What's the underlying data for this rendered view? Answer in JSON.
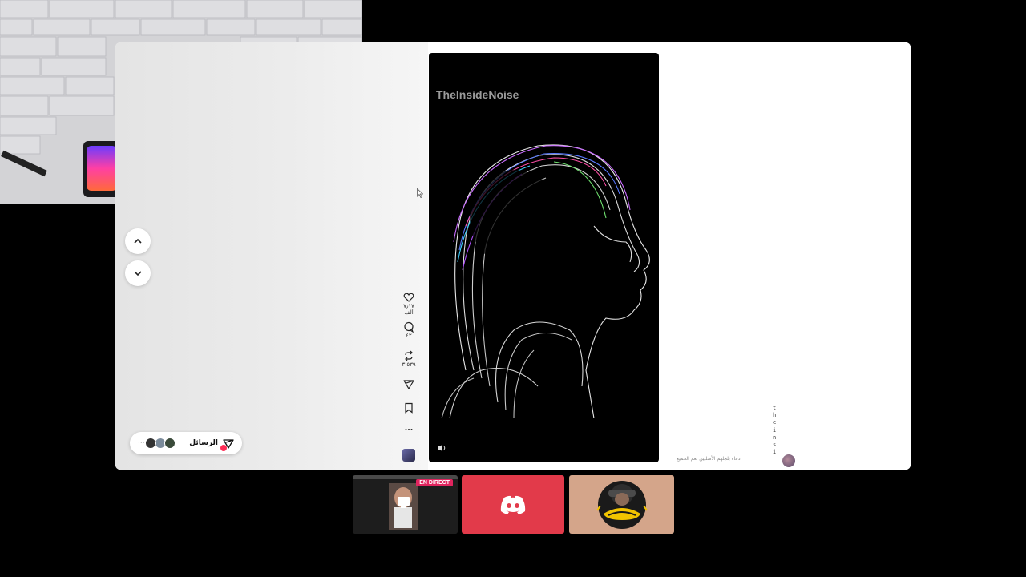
{
  "feed": {
    "watermark": "TheInsideNoise",
    "likes_count": "٧٫١٧ ألف",
    "comments_count": "٤٢",
    "reposts_count": "٣٬٥٣٩",
    "messages_label": "الرسائل",
    "messages_more": "···",
    "side_vertical_text": "theinsi",
    "side_tiny_text": "دعاء بلجلهم الأصليين نعم الجميع"
  },
  "dock": {
    "live_badge": "EN DIRECT",
    "discord_icon": "discord-icon",
    "logo_icon": "outbalt-logo"
  },
  "colors": {
    "accent": "#fe2c55",
    "discord_tile": "#e23a4a",
    "logo_tile": "#d4a58a",
    "live_badge": "#e0245e"
  }
}
